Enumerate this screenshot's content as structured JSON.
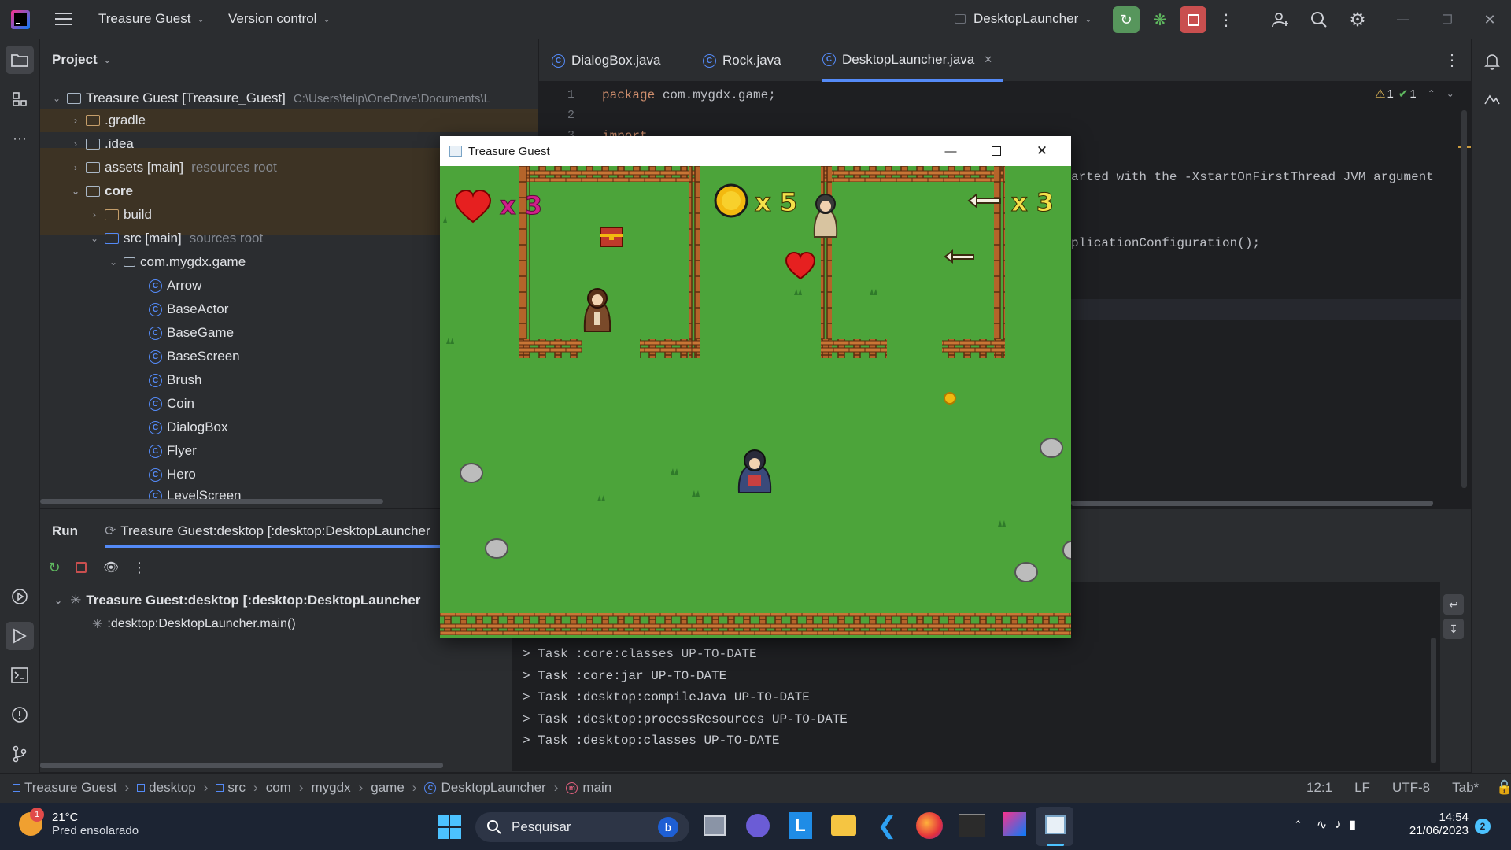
{
  "titlebar": {
    "project_name": "Treasure Guest",
    "vcs": "Version control",
    "run_config": "DesktopLauncher"
  },
  "project_panel": {
    "title": "Project",
    "root_label": "Treasure Guest [Treasure_Guest]",
    "root_path": "C:\\Users\\felip\\OneDrive\\Documents\\L",
    "items": [
      {
        "label": ".gradle",
        "hint": ""
      },
      {
        "label": ".idea",
        "hint": ""
      },
      {
        "label": "assets [main]",
        "hint": "resources root"
      },
      {
        "label": "core",
        "hint": ""
      },
      {
        "label": "build",
        "hint": ""
      },
      {
        "label": "src [main]",
        "hint": "sources root"
      },
      {
        "label": "com.mygdx.game",
        "hint": ""
      }
    ],
    "classes": [
      "Arrow",
      "BaseActor",
      "BaseGame",
      "BaseScreen",
      "Brush",
      "Coin",
      "DialogBox",
      "Flyer",
      "Hero",
      "LevelScreen"
    ]
  },
  "editor": {
    "tabs": [
      "DialogBox.java",
      "Rock.java",
      "DesktopLauncher.java"
    ],
    "warnings": "1",
    "checks": "1",
    "line_numbers": [
      "1",
      "2",
      "3"
    ],
    "code_line1_kw": "package",
    "code_line1_rest": " com.mygdx.game;",
    "code_line3": "import ...",
    "code_partial1": "arted with the -XstartOnFirstThread JVM argument",
    "code_partial2": "plicationConfiguration();"
  },
  "run": {
    "label": "Run",
    "tab_title": "Treasure Guest:desktop [:desktop:DesktopLauncher",
    "tree_root": "Treasure Guest:desktop [:desktop:DesktopLauncher",
    "tree_child": ":desktop:DesktopLauncher.main()",
    "console": [
      "> Task :core:classes UP-TO-DATE",
      "> Task :core:jar UP-TO-DATE",
      "> Task :desktop:compileJava UP-TO-DATE",
      "> Task :desktop:processResources UP-TO-DATE",
      "> Task :desktop:classes UP-TO-DATE"
    ]
  },
  "breadcrumb": {
    "items": [
      "Treasure Guest",
      "desktop",
      "src",
      "com",
      "mygdx",
      "game",
      "DesktopLauncher",
      "main"
    ],
    "position": "12:1",
    "line_sep": "LF",
    "encoding": "UTF-8",
    "indent": "Tab*"
  },
  "game": {
    "window_title": "Treasure Guest",
    "hearts": "x 3",
    "coins": "x 5",
    "arrows": "x 3"
  },
  "taskbar": {
    "weather_temp": "21°C",
    "weather_desc": "Pred ensolarado",
    "weather_badge": "1",
    "search_placeholder": "Pesquisar",
    "time": "14:54",
    "date": "21/06/2023",
    "notif_count": "2"
  },
  "colors": {
    "accent": "#548af7",
    "run_green": "#57965c",
    "stop_red": "#c94f4f",
    "grass": "#4ca43a",
    "fence": "#b5642a"
  }
}
